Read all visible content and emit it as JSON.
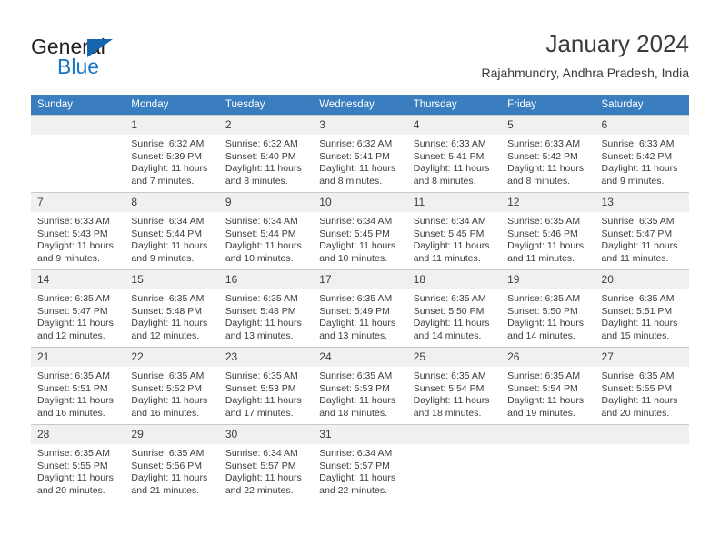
{
  "brand": {
    "name_part1": "General",
    "name_part2": "Blue",
    "triangle_color": "#1565b0",
    "blue_color": "#1a76c6"
  },
  "header": {
    "title": "January 2024",
    "subtitle": "Rajahmundry, Andhra Pradesh, India"
  },
  "calendar": {
    "header_bg": "#3a7ebf",
    "daynum_bg": "#f0f0f0",
    "weekday_headers": [
      "Sunday",
      "Monday",
      "Tuesday",
      "Wednesday",
      "Thursday",
      "Friday",
      "Saturday"
    ],
    "weeks": [
      [
        {
          "day": "",
          "empty": true,
          "sunrise": "",
          "sunset": "",
          "daylight": ""
        },
        {
          "day": "1",
          "sunrise": "Sunrise: 6:32 AM",
          "sunset": "Sunset: 5:39 PM",
          "daylight": "Daylight: 11 hours and 7 minutes."
        },
        {
          "day": "2",
          "sunrise": "Sunrise: 6:32 AM",
          "sunset": "Sunset: 5:40 PM",
          "daylight": "Daylight: 11 hours and 8 minutes."
        },
        {
          "day": "3",
          "sunrise": "Sunrise: 6:32 AM",
          "sunset": "Sunset: 5:41 PM",
          "daylight": "Daylight: 11 hours and 8 minutes."
        },
        {
          "day": "4",
          "sunrise": "Sunrise: 6:33 AM",
          "sunset": "Sunset: 5:41 PM",
          "daylight": "Daylight: 11 hours and 8 minutes."
        },
        {
          "day": "5",
          "sunrise": "Sunrise: 6:33 AM",
          "sunset": "Sunset: 5:42 PM",
          "daylight": "Daylight: 11 hours and 8 minutes."
        },
        {
          "day": "6",
          "sunrise": "Sunrise: 6:33 AM",
          "sunset": "Sunset: 5:42 PM",
          "daylight": "Daylight: 11 hours and 9 minutes."
        }
      ],
      [
        {
          "day": "7",
          "sunrise": "Sunrise: 6:33 AM",
          "sunset": "Sunset: 5:43 PM",
          "daylight": "Daylight: 11 hours and 9 minutes."
        },
        {
          "day": "8",
          "sunrise": "Sunrise: 6:34 AM",
          "sunset": "Sunset: 5:44 PM",
          "daylight": "Daylight: 11 hours and 9 minutes."
        },
        {
          "day": "9",
          "sunrise": "Sunrise: 6:34 AM",
          "sunset": "Sunset: 5:44 PM",
          "daylight": "Daylight: 11 hours and 10 minutes."
        },
        {
          "day": "10",
          "sunrise": "Sunrise: 6:34 AM",
          "sunset": "Sunset: 5:45 PM",
          "daylight": "Daylight: 11 hours and 10 minutes."
        },
        {
          "day": "11",
          "sunrise": "Sunrise: 6:34 AM",
          "sunset": "Sunset: 5:45 PM",
          "daylight": "Daylight: 11 hours and 11 minutes."
        },
        {
          "day": "12",
          "sunrise": "Sunrise: 6:35 AM",
          "sunset": "Sunset: 5:46 PM",
          "daylight": "Daylight: 11 hours and 11 minutes."
        },
        {
          "day": "13",
          "sunrise": "Sunrise: 6:35 AM",
          "sunset": "Sunset: 5:47 PM",
          "daylight": "Daylight: 11 hours and 11 minutes."
        }
      ],
      [
        {
          "day": "14",
          "sunrise": "Sunrise: 6:35 AM",
          "sunset": "Sunset: 5:47 PM",
          "daylight": "Daylight: 11 hours and 12 minutes."
        },
        {
          "day": "15",
          "sunrise": "Sunrise: 6:35 AM",
          "sunset": "Sunset: 5:48 PM",
          "daylight": "Daylight: 11 hours and 12 minutes."
        },
        {
          "day": "16",
          "sunrise": "Sunrise: 6:35 AM",
          "sunset": "Sunset: 5:48 PM",
          "daylight": "Daylight: 11 hours and 13 minutes."
        },
        {
          "day": "17",
          "sunrise": "Sunrise: 6:35 AM",
          "sunset": "Sunset: 5:49 PM",
          "daylight": "Daylight: 11 hours and 13 minutes."
        },
        {
          "day": "18",
          "sunrise": "Sunrise: 6:35 AM",
          "sunset": "Sunset: 5:50 PM",
          "daylight": "Daylight: 11 hours and 14 minutes."
        },
        {
          "day": "19",
          "sunrise": "Sunrise: 6:35 AM",
          "sunset": "Sunset: 5:50 PM",
          "daylight": "Daylight: 11 hours and 14 minutes."
        },
        {
          "day": "20",
          "sunrise": "Sunrise: 6:35 AM",
          "sunset": "Sunset: 5:51 PM",
          "daylight": "Daylight: 11 hours and 15 minutes."
        }
      ],
      [
        {
          "day": "21",
          "sunrise": "Sunrise: 6:35 AM",
          "sunset": "Sunset: 5:51 PM",
          "daylight": "Daylight: 11 hours and 16 minutes."
        },
        {
          "day": "22",
          "sunrise": "Sunrise: 6:35 AM",
          "sunset": "Sunset: 5:52 PM",
          "daylight": "Daylight: 11 hours and 16 minutes."
        },
        {
          "day": "23",
          "sunrise": "Sunrise: 6:35 AM",
          "sunset": "Sunset: 5:53 PM",
          "daylight": "Daylight: 11 hours and 17 minutes."
        },
        {
          "day": "24",
          "sunrise": "Sunrise: 6:35 AM",
          "sunset": "Sunset: 5:53 PM",
          "daylight": "Daylight: 11 hours and 18 minutes."
        },
        {
          "day": "25",
          "sunrise": "Sunrise: 6:35 AM",
          "sunset": "Sunset: 5:54 PM",
          "daylight": "Daylight: 11 hours and 18 minutes."
        },
        {
          "day": "26",
          "sunrise": "Sunrise: 6:35 AM",
          "sunset": "Sunset: 5:54 PM",
          "daylight": "Daylight: 11 hours and 19 minutes."
        },
        {
          "day": "27",
          "sunrise": "Sunrise: 6:35 AM",
          "sunset": "Sunset: 5:55 PM",
          "daylight": "Daylight: 11 hours and 20 minutes."
        }
      ],
      [
        {
          "day": "28",
          "sunrise": "Sunrise: 6:35 AM",
          "sunset": "Sunset: 5:55 PM",
          "daylight": "Daylight: 11 hours and 20 minutes."
        },
        {
          "day": "29",
          "sunrise": "Sunrise: 6:35 AM",
          "sunset": "Sunset: 5:56 PM",
          "daylight": "Daylight: 11 hours and 21 minutes."
        },
        {
          "day": "30",
          "sunrise": "Sunrise: 6:34 AM",
          "sunset": "Sunset: 5:57 PM",
          "daylight": "Daylight: 11 hours and 22 minutes."
        },
        {
          "day": "31",
          "sunrise": "Sunrise: 6:34 AM",
          "sunset": "Sunset: 5:57 PM",
          "daylight": "Daylight: 11 hours and 22 minutes."
        },
        {
          "day": "",
          "empty": true,
          "sunrise": "",
          "sunset": "",
          "daylight": ""
        },
        {
          "day": "",
          "empty": true,
          "sunrise": "",
          "sunset": "",
          "daylight": ""
        },
        {
          "day": "",
          "empty": true,
          "sunrise": "",
          "sunset": "",
          "daylight": ""
        }
      ]
    ]
  }
}
